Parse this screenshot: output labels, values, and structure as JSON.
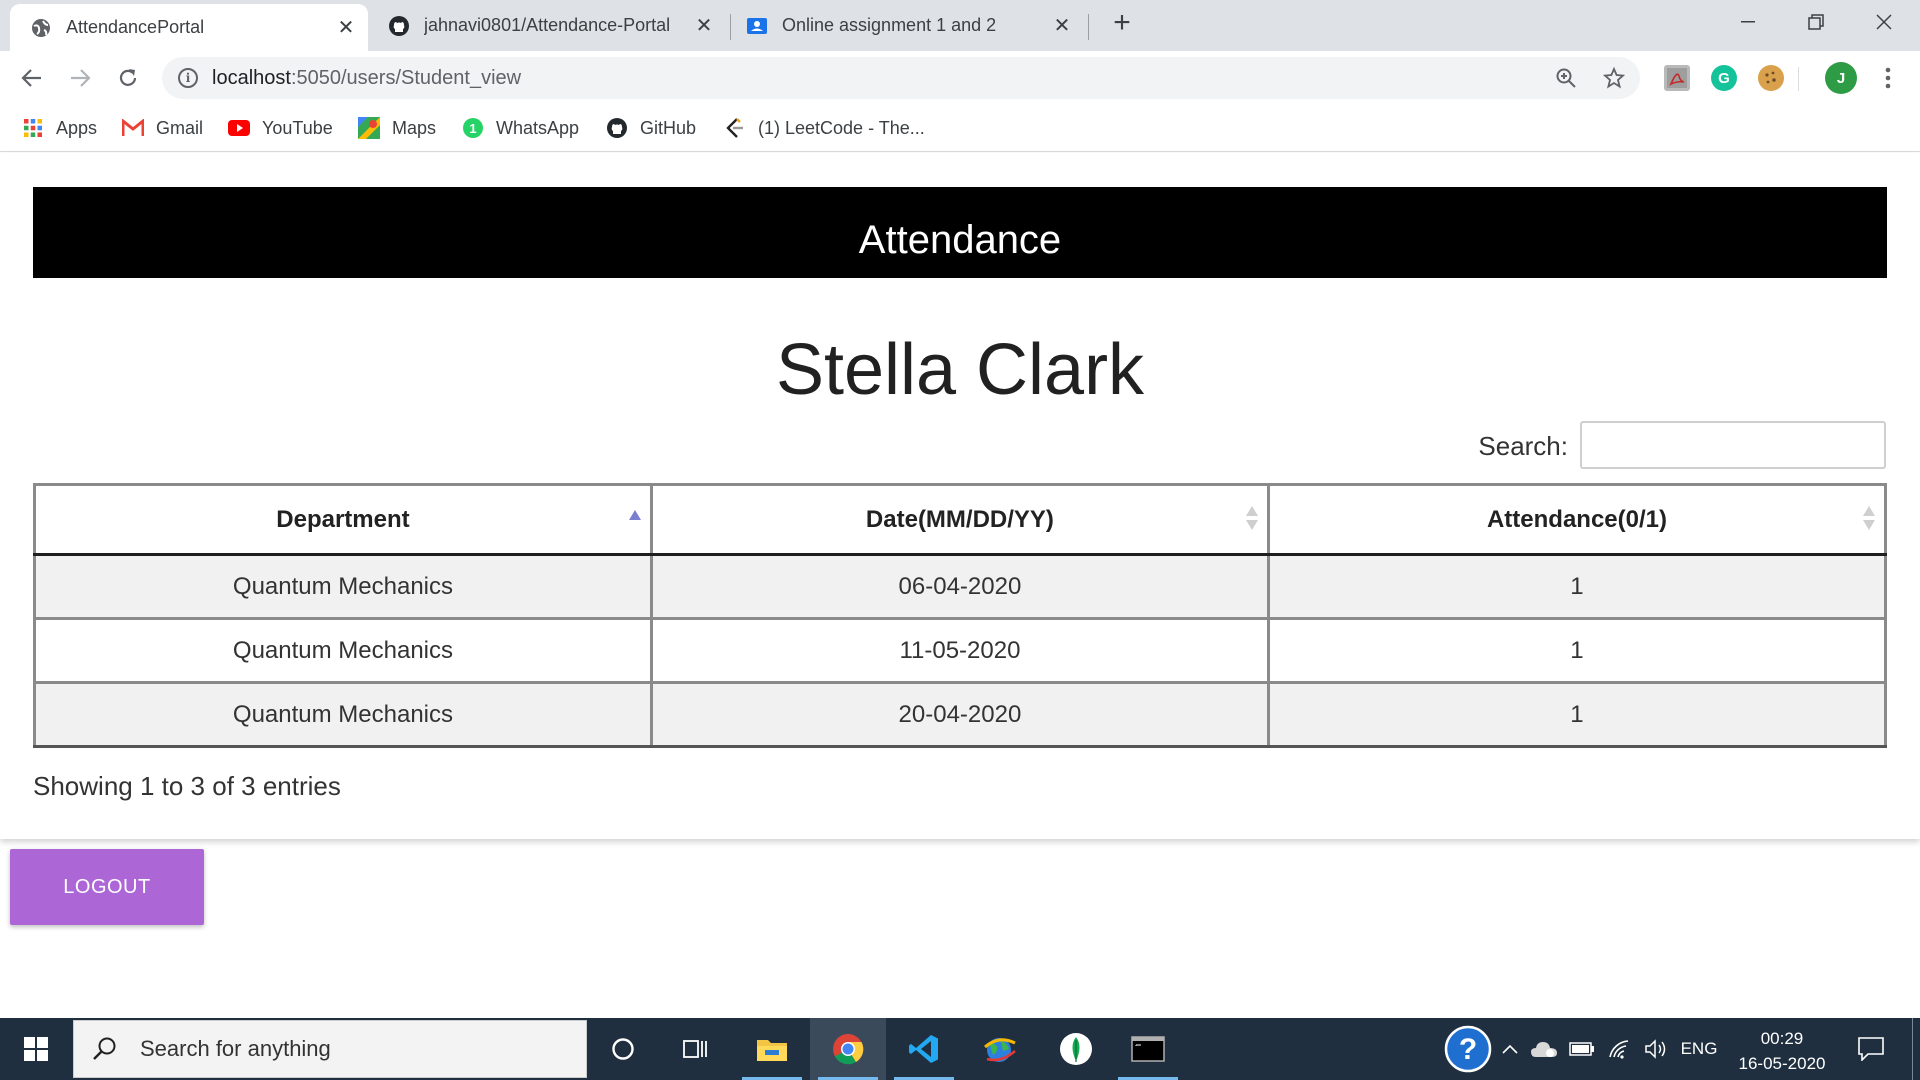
{
  "browser": {
    "tabs": [
      {
        "title": "AttendancePortal",
        "favicon": "globe-icon",
        "active": true
      },
      {
        "title": "jahnavi0801/Attendance-Portal",
        "favicon": "github-icon",
        "active": false
      },
      {
        "title": "Online assignment 1 and 2",
        "favicon": "classroom-icon",
        "active": false
      }
    ],
    "url_host": "localhost",
    "url_path": ":5050/users/Student_view",
    "bookmarks": [
      {
        "label": "Apps",
        "icon": "apps-grid-icon"
      },
      {
        "label": "Gmail",
        "icon": "gmail-icon"
      },
      {
        "label": "YouTube",
        "icon": "youtube-icon"
      },
      {
        "label": "Maps",
        "icon": "maps-icon"
      },
      {
        "label": "WhatsApp",
        "icon": "whatsapp-icon"
      },
      {
        "label": "GitHub",
        "icon": "github-icon"
      },
      {
        "label": "(1) LeetCode - The...",
        "icon": "leetcode-icon"
      }
    ],
    "profile_initial": "J"
  },
  "page": {
    "header_title": "Attendance",
    "student_name": "Stella Clark",
    "search_label": "Search:",
    "search_value": "",
    "table": {
      "columns": [
        "Department",
        "Date(MM/DD/YY)",
        "Attendance(0/1)"
      ],
      "rows": [
        [
          "Quantum Mechanics",
          "06-04-2020",
          "1"
        ],
        [
          "Quantum Mechanics",
          "11-05-2020",
          "1"
        ],
        [
          "Quantum Mechanics",
          "20-04-2020",
          "1"
        ]
      ]
    },
    "info": "Showing 1 to 3 of 3 entries",
    "logout_label": "LOGOUT"
  },
  "taskbar": {
    "search_placeholder": "Search for anything",
    "language": "ENG",
    "time": "00:29",
    "date": "16-05-2020"
  },
  "colors": {
    "logout_button": "#ac66d6",
    "header_bg": "#000000",
    "sort_active": "#7b7fd1",
    "taskbar_bg": "#1f2f3f"
  }
}
